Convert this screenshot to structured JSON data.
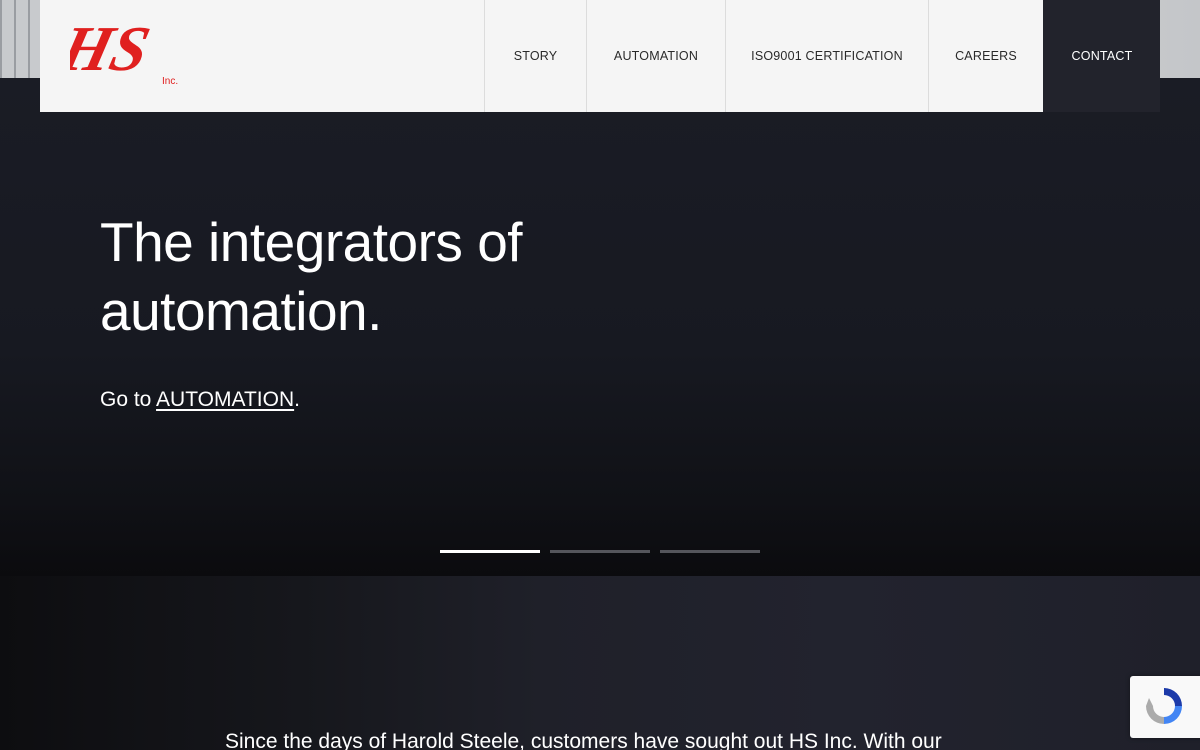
{
  "brand": {
    "logo_text": "HS",
    "logo_suffix": "Inc.",
    "logo_color": "#e0201f"
  },
  "nav": {
    "items": [
      {
        "label": "STORY",
        "active": false
      },
      {
        "label": "AUTOMATION",
        "active": false
      },
      {
        "label": "ISO9001 CERTIFICATION",
        "active": false
      },
      {
        "label": "CAREERS",
        "active": false
      },
      {
        "label": "CONTACT",
        "active": true
      }
    ]
  },
  "hero": {
    "title_line1": "The integrators of",
    "title_line2": "automation.",
    "cta_prefix": "Go to ",
    "cta_link": "AUTOMATION",
    "cta_suffix": "."
  },
  "slider": {
    "slides": 3,
    "active_index": 0
  },
  "intro": {
    "text": "Since the days of Harold Steele, customers have sought out HS Inc. With our"
  },
  "recaptcha": {
    "icon": "recaptcha-icon"
  }
}
